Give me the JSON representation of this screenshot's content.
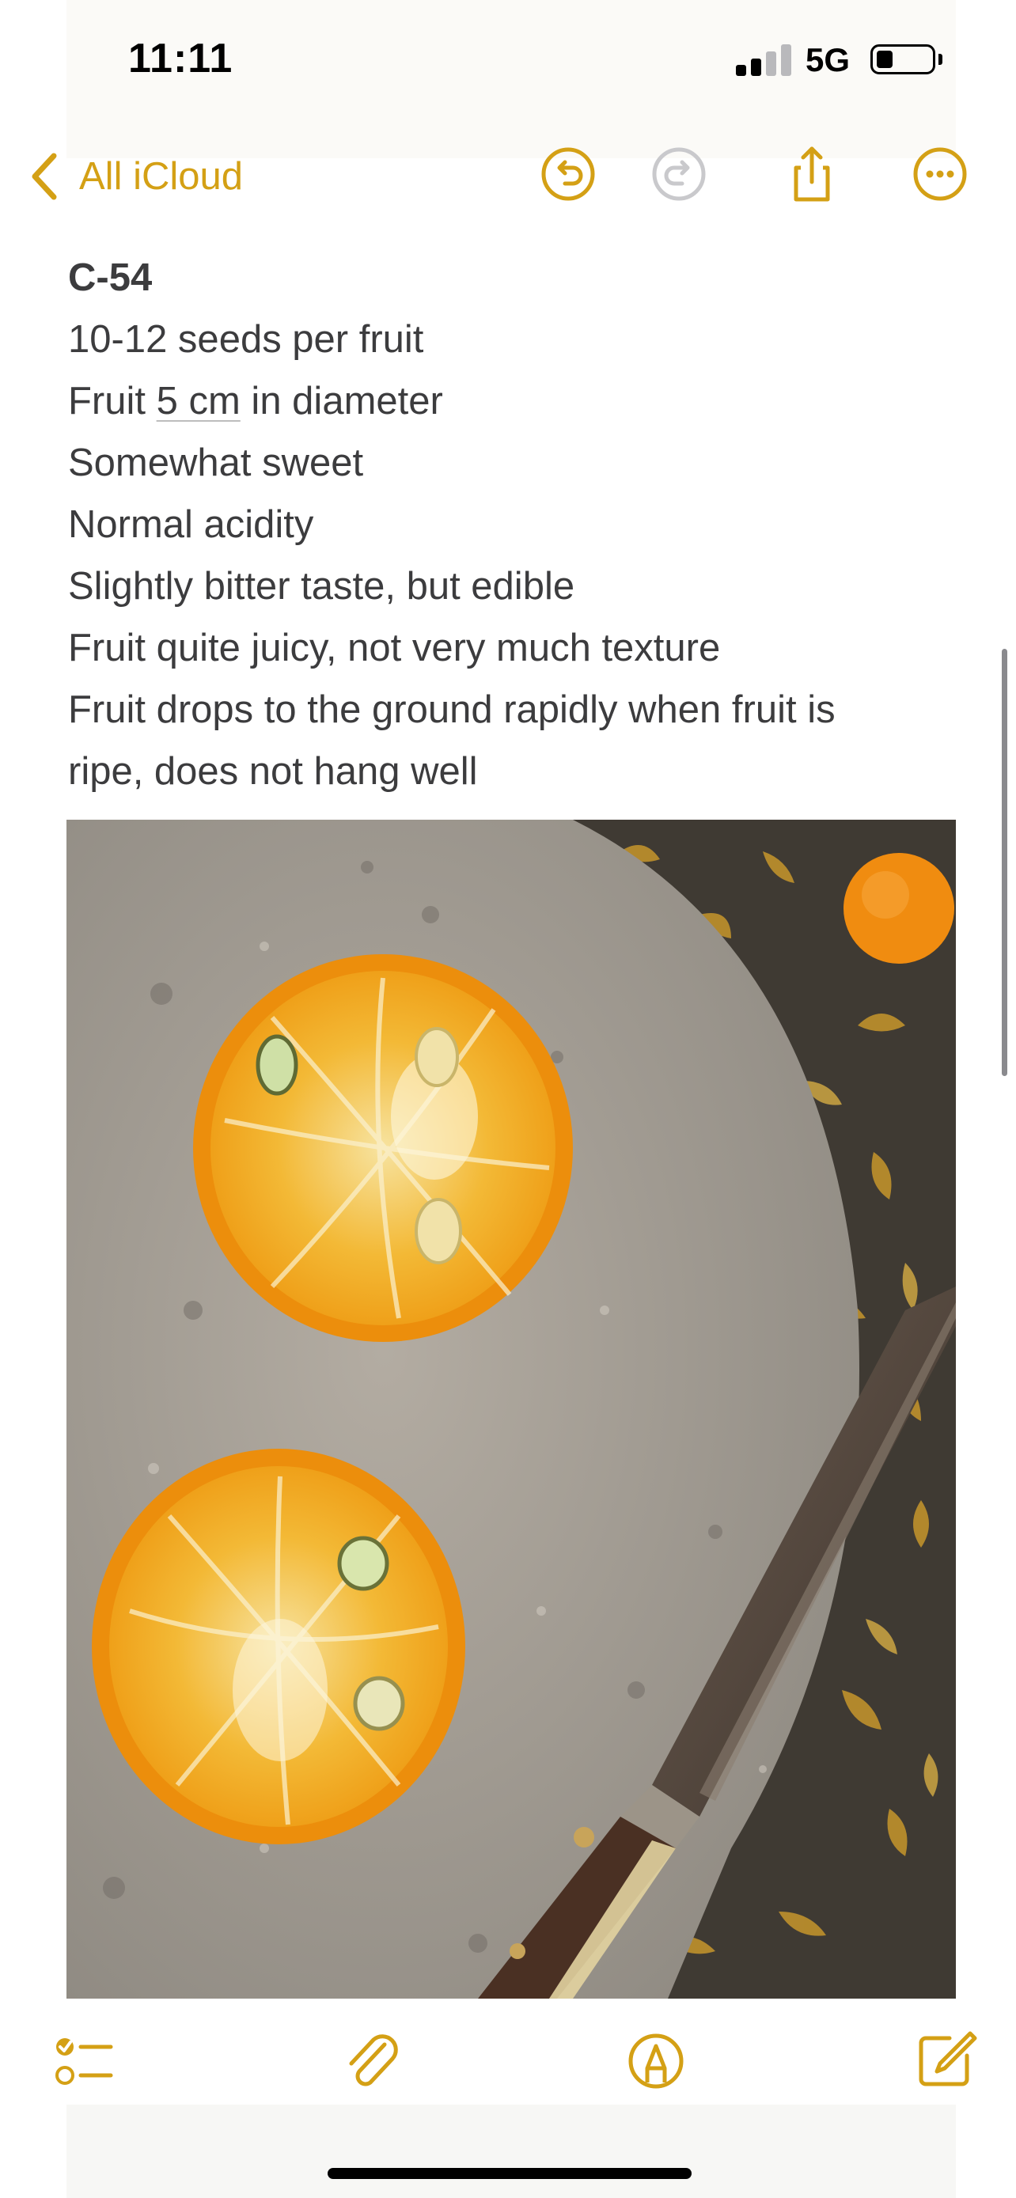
{
  "status_bar": {
    "time": "11:11",
    "network": "5G"
  },
  "nav": {
    "back_label": "All iCloud",
    "accent_color": "#d4a015",
    "icons": [
      "chevron-left-icon",
      "undo-icon",
      "redo-icon",
      "share-icon",
      "more-icon"
    ]
  },
  "note": {
    "title": "C-54",
    "lines": [
      "10-12 seeds per fruit",
      "Fruit ",
      "5 cm",
      " in diameter",
      "Somewhat sweet",
      "Normal acidity",
      "Slightly bitter taste, but edible",
      "Fruit quite juicy, not very much texture",
      "Fruit drops to the ground rapidly when fruit is",
      "ripe, does not hang well"
    ]
  },
  "photo": {
    "subject": "two halved oranges with seeds on a stone slab beside a knife and dry leaves"
  },
  "toolbar": {
    "icons": [
      "checklist-icon",
      "paperclip-icon",
      "markup-pen-icon",
      "compose-icon"
    ]
  }
}
